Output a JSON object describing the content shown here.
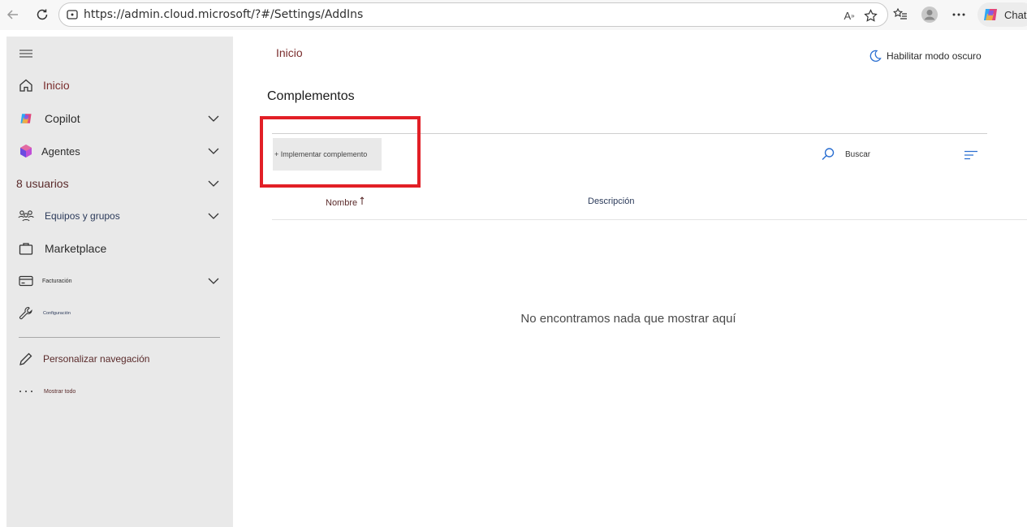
{
  "browser": {
    "url": "https://admin.cloud.microsoft/?#/Settings/AddIns",
    "chat_label": "Chat"
  },
  "header": {
    "breadcrumb": "Inicio",
    "dark_mode_label": "Habilitar modo oscuro"
  },
  "sidebar": {
    "items": [
      {
        "label": "Inicio",
        "has_chevron": false
      },
      {
        "label": "Copilot",
        "has_chevron": true
      },
      {
        "label": "Agentes",
        "has_chevron": true
      },
      {
        "label": "8 usuarios",
        "has_chevron": true
      },
      {
        "label": "Equipos y grupos",
        "has_chevron": true
      },
      {
        "label": "Marketplace",
        "has_chevron": false
      },
      {
        "label": "Facturación",
        "has_chevron": true
      },
      {
        "label": "Configuración",
        "has_chevron": false
      },
      {
        "label": "Personalizar navegación",
        "has_chevron": false
      },
      {
        "label": "Mostrar todo",
        "has_chevron": false
      }
    ]
  },
  "main": {
    "title": "Complementos",
    "deploy_button": "+ Implementar complemento",
    "search_placeholder": "Buscar",
    "columns": {
      "name": "Nombre",
      "description": "Descripción"
    },
    "empty_message": "No encontramos nada que mostrar aquí"
  },
  "colors": {
    "highlight": "#e21f26",
    "link": "#7a2d2d",
    "accent_blue": "#2b6fd1",
    "sidebar_bg": "#e9e9e9"
  }
}
